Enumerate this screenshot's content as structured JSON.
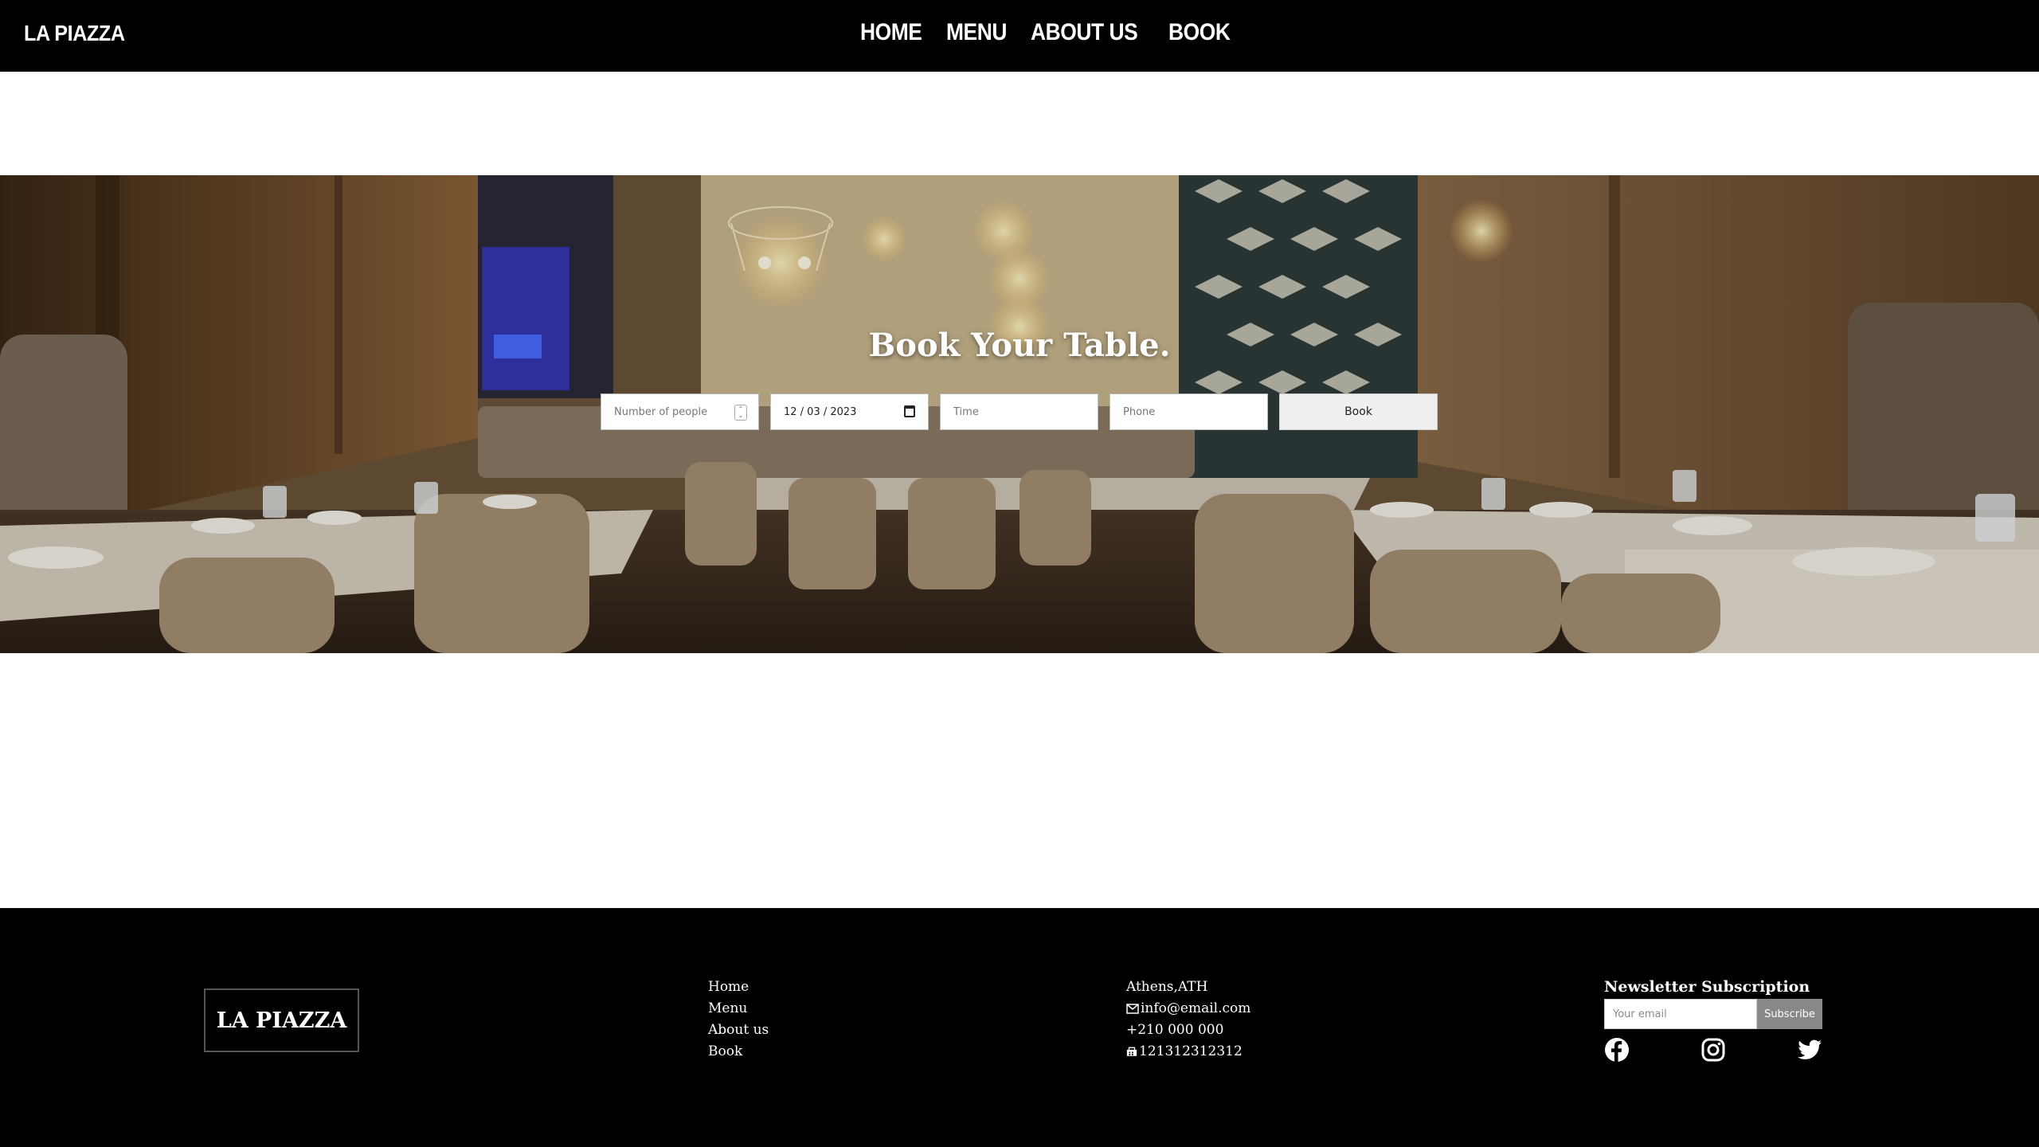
{
  "nav": {
    "brand": "LA PIAZZA",
    "links": [
      "HOME",
      "MENU",
      "ABOUT US",
      "BOOK"
    ]
  },
  "hero": {
    "title": "Book Your Table.",
    "form": {
      "people_placeholder": "Number of people",
      "date_value": "12 / 03 / 2023",
      "time_placeholder": "Time",
      "phone_placeholder": "Phone",
      "submit_label": "Book"
    }
  },
  "footer": {
    "logo": "LA PIAZZA",
    "links": [
      "Home",
      "Menu",
      "About us",
      "Book"
    ],
    "contact": {
      "address": "Athens,ATH",
      "email": "info@email.com",
      "phone": "+210 000 000",
      "fax": "121312312312"
    },
    "newsletter": {
      "title": "Newsletter Subscription",
      "placeholder": "Your email",
      "button": "Subscribe"
    },
    "socials": [
      "facebook-icon",
      "instagram-icon",
      "twitter-icon"
    ]
  },
  "colors": {
    "nav_bg": "#000000",
    "footer_bg": "#000000",
    "text_light": "#ffffff",
    "subscribe_bg": "#888888"
  }
}
